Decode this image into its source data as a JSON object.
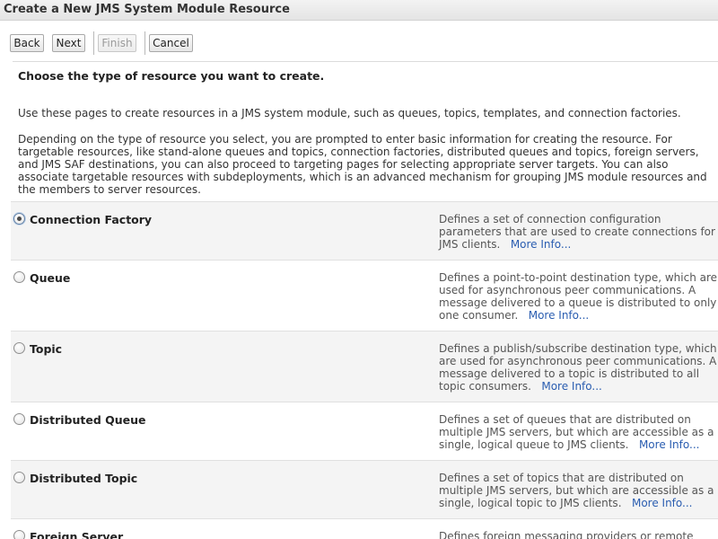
{
  "page": {
    "title": "Create a New JMS System Module Resource"
  },
  "toolbar": {
    "back_label": "Back",
    "next_label": "Next",
    "finish_label": "Finish",
    "cancel_label": "Cancel"
  },
  "content": {
    "heading": "Choose the type of resource you want to create.",
    "intro": "Use these pages to create resources in a JMS system module, such as queues, topics, templates, and connection factories.",
    "details": "Depending on the type of resource you select, you are prompted to enter basic information for creating the resource. For targetable resources, like stand-alone queues and topics, connection factories, distributed queues and topics, foreign servers, and JMS SAF destinations, you can also proceed to targeting pages for selecting appropriate server targets. You can also associate targetable resources with subdeployments, which is an advanced mechanism for grouping JMS module resources and the members to server resources."
  },
  "resource_types": [
    {
      "name": "Connection Factory",
      "description": "Defines a set of connection configuration parameters that are used to create connections for JMS clients.",
      "more_info": "More Info...",
      "selected": true
    },
    {
      "name": "Queue",
      "description": "Defines a point-to-point destination type, which are used for asynchronous peer communications. A message delivered to a queue is distributed to only one consumer.",
      "more_info": "More Info...",
      "selected": false
    },
    {
      "name": "Topic",
      "description": "Defines a publish/subscribe destination type, which are used for asynchronous peer communications. A message delivered to a topic is distributed to all topic consumers.",
      "more_info": "More Info...",
      "selected": false
    },
    {
      "name": "Distributed Queue",
      "description": "Defines a set of queues that are distributed on multiple JMS servers, but which are accessible as a single, logical queue to JMS clients.",
      "more_info": "More Info...",
      "selected": false
    },
    {
      "name": "Distributed Topic",
      "description": "Defines a set of topics that are distributed on multiple JMS servers, but which are accessible as a single, logical topic to JMS clients.",
      "more_info": "More Info...",
      "selected": false
    },
    {
      "name": "Foreign Server",
      "description": "Defines foreign messaging providers or remote WebLogic",
      "more_info": "",
      "selected": false
    }
  ],
  "colors": {
    "link": "#2a5db0",
    "alt_row": "#f4f4f4",
    "title_bar": "#e9e9e9"
  }
}
